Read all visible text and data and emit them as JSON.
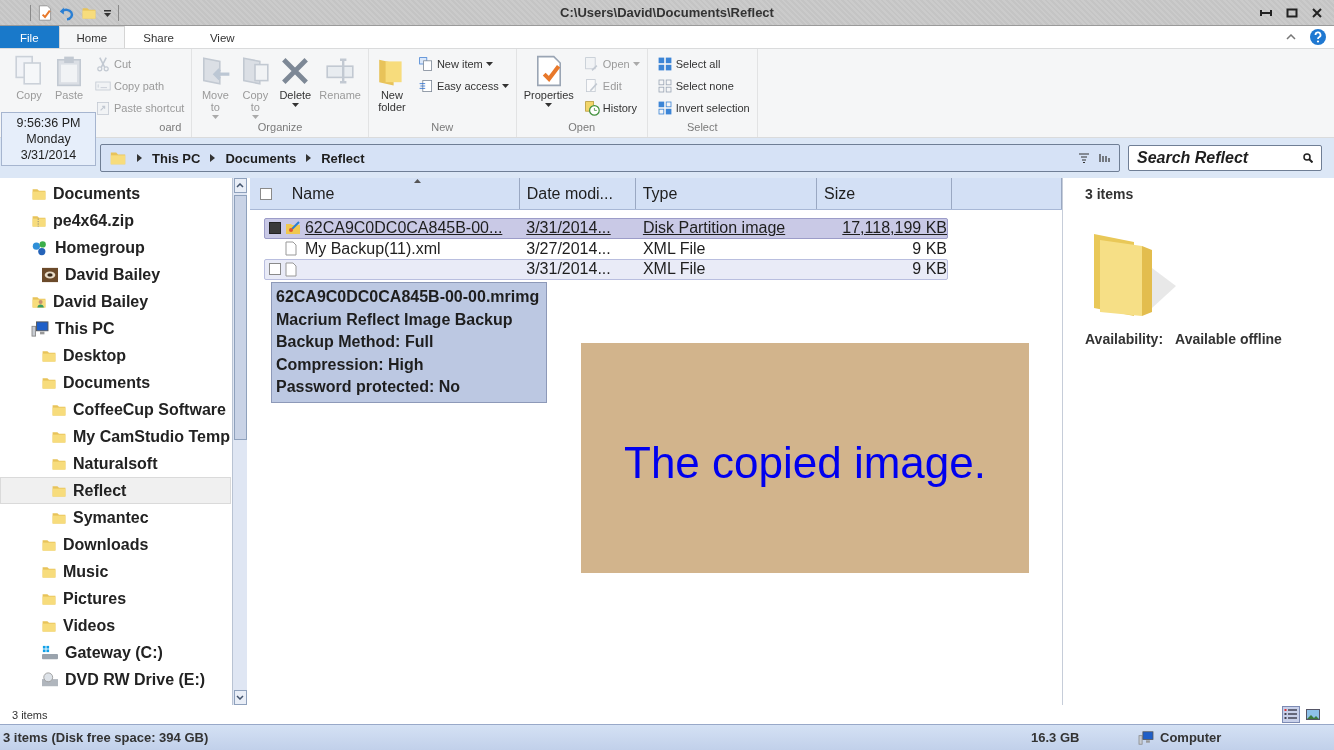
{
  "window": {
    "title": "C:\\Users\\David\\Documents\\Reflect"
  },
  "ribbon_tabs": [
    {
      "label": "File",
      "kind": "file",
      "selected": false
    },
    {
      "label": "Home",
      "kind": "tab",
      "selected": true
    },
    {
      "label": "Share",
      "kind": "tab",
      "selected": false
    },
    {
      "label": "View",
      "kind": "tab",
      "selected": false
    }
  ],
  "ribbon_groups": [
    {
      "label": "oard",
      "items": [
        {
          "label": "Copy",
          "kind": "large",
          "disabled": true,
          "dropdown": false
        },
        {
          "label": "Paste",
          "kind": "large",
          "disabled": true,
          "dropdown": false
        },
        {
          "label": "Cut",
          "kind": "small",
          "disabled": true,
          "dropdown": false
        },
        {
          "label": "Copy path",
          "kind": "small",
          "disabled": true,
          "dropdown": false
        },
        {
          "label": "Paste shortcut",
          "kind": "small",
          "disabled": true,
          "dropdown": false
        }
      ]
    },
    {
      "label": "Organize",
      "items": [
        {
          "label": "Move to",
          "kind": "large",
          "disabled": true,
          "dropdown": true
        },
        {
          "label": "Copy to",
          "kind": "large",
          "disabled": true,
          "dropdown": true
        },
        {
          "label": "Delete",
          "kind": "large",
          "disabled": false,
          "dropdown": true
        },
        {
          "label": "Rename",
          "kind": "large",
          "disabled": true,
          "dropdown": false
        }
      ]
    },
    {
      "label": "New",
      "items": [
        {
          "label": "New folder",
          "kind": "large",
          "disabled": false,
          "dropdown": false
        },
        {
          "label": "New item",
          "kind": "small",
          "disabled": false,
          "dropdown": true
        },
        {
          "label": "Easy access",
          "kind": "small",
          "disabled": false,
          "dropdown": true
        }
      ]
    },
    {
      "label": "Open",
      "items": [
        {
          "label": "Properties",
          "kind": "large",
          "disabled": false,
          "dropdown": true
        },
        {
          "label": "Open",
          "kind": "small",
          "disabled": true,
          "dropdown": true
        },
        {
          "label": "Edit",
          "kind": "small",
          "disabled": true,
          "dropdown": false
        },
        {
          "label": "History",
          "kind": "small",
          "disabled": false,
          "dropdown": false
        }
      ]
    },
    {
      "label": "Select",
      "items": [
        {
          "label": "Select all",
          "kind": "small",
          "disabled": false,
          "dropdown": false
        },
        {
          "label": "Select none",
          "kind": "small",
          "disabled": false,
          "dropdown": false
        },
        {
          "label": "Invert selection",
          "kind": "small",
          "disabled": false,
          "dropdown": false
        }
      ]
    }
  ],
  "clock_tooltip": {
    "time": "9:56:36 PM",
    "day": "Monday",
    "date": "3/31/2014"
  },
  "address_bar": {
    "crumbs": [
      "This PC",
      "Documents",
      "Reflect"
    ]
  },
  "search": {
    "placeholder": "Search Reflect"
  },
  "navigation_tree": [
    {
      "label": "Documents",
      "kind": "folder",
      "selected": false
    },
    {
      "label": "pe4x64.zip",
      "kind": "zip",
      "selected": false
    },
    {
      "label": "Homegroup",
      "kind": "homegroup",
      "selected": false,
      "children": [
        {
          "label": "David Bailey",
          "kind": "user",
          "selected": false
        }
      ]
    },
    {
      "label": "David Bailey",
      "kind": "userfolder",
      "selected": false
    },
    {
      "label": "This PC",
      "kind": "pc",
      "selected": false,
      "children": [
        {
          "label": "Desktop",
          "kind": "folder",
          "selected": false
        },
        {
          "label": "Documents",
          "kind": "folder",
          "selected": false,
          "children": [
            {
              "label": "CoffeeCup Software",
              "kind": "folder",
              "selected": false
            },
            {
              "label": "My CamStudio Temp",
              "kind": "folder",
              "selected": false
            },
            {
              "label": "Naturalsoft",
              "kind": "folder",
              "selected": false
            },
            {
              "label": "Reflect",
              "kind": "folder",
              "selected": true
            },
            {
              "label": "Symantec",
              "kind": "folder",
              "selected": false
            }
          ]
        },
        {
          "label": "Downloads",
          "kind": "folder",
          "selected": false
        },
        {
          "label": "Music",
          "kind": "folder",
          "selected": false
        },
        {
          "label": "Pictures",
          "kind": "folder",
          "selected": false
        },
        {
          "label": "Videos",
          "kind": "folder",
          "selected": false
        },
        {
          "label": "Gateway (C:)",
          "kind": "drive",
          "selected": false
        },
        {
          "label": "DVD RW Drive (E:)",
          "kind": "dvd",
          "selected": false
        }
      ]
    }
  ],
  "file_list": {
    "header_checkbox": {
      "checked": false
    },
    "columns": [
      "Name",
      "Date modi...",
      "Type",
      "Size"
    ],
    "rows": [
      {
        "name": "62CA9C0DC0CA845B-00...",
        "date": "3/31/2014...",
        "type": "Disk Partition image",
        "size": "17,118,199 KB",
        "kind": "image",
        "selected": true,
        "checked": true,
        "hot": true
      },
      {
        "name": "My Backup(11).xml",
        "date": "3/27/2014...",
        "type": "XML File",
        "size": "9 KB",
        "kind": "document",
        "selected": false,
        "hot": false
      },
      {
        "date": "3/31/2014...",
        "type": "XML File",
        "size": "9 KB",
        "kind": "document",
        "selected": true,
        "checked": false,
        "hot": false
      }
    ]
  },
  "file_tooltip": [
    "62CA9C0DC0CA845B-00-00.mrimg",
    "Macrium Reflect Image Backup",
    "Backup Method: Full",
    "Compression: High",
    "Password protected: No"
  ],
  "overlay_note": {
    "text": "The copied image."
  },
  "details_pane": {
    "count": "3 items",
    "availability_label": "Availability:",
    "availability_value": "Available offline"
  },
  "status_row": {
    "text": "3 items",
    "views": [
      {
        "kind": "details",
        "selected": true
      },
      {
        "kind": "thumbnails",
        "selected": false
      }
    ]
  },
  "status_bar": {
    "summary": "3 items (Disk free space: 394 GB)",
    "size": "16.3 GB",
    "location": "Computer"
  }
}
